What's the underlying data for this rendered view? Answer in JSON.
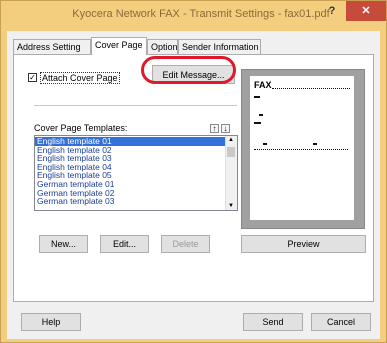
{
  "window": {
    "title": "Kyocera Network FAX - Transmit Settings - fax01.pdf",
    "help_glyph": "?",
    "close_glyph": "✕"
  },
  "tabs": [
    {
      "label": "Address Setting"
    },
    {
      "label": "Cover Page"
    },
    {
      "label": "Option"
    },
    {
      "label": "Sender Information"
    }
  ],
  "cover_page": {
    "attach_label": "Attach Cover Page",
    "attach_checked": "✓",
    "edit_message_label": "Edit Message...",
    "templates_label": "Cover Page Templates:",
    "sort_up": "↑",
    "sort_down": "↓",
    "templates": [
      "English template 01",
      "English template 02",
      "English template 03",
      "English template 04",
      "English template 05",
      "German template 01",
      "German template 02",
      "German template 03"
    ],
    "selected_index": 0,
    "new_label": "New...",
    "edit_label": "Edit...",
    "delete_label": "Delete",
    "preview_label": "Preview",
    "preview_page_title": "FAX"
  },
  "footer": {
    "help_label": "Help",
    "send_label": "Send",
    "cancel_label": "Cancel"
  },
  "colors": {
    "title_bar": "#f3ce7f",
    "close_button": "#c74b3b",
    "selection": "#3370d8",
    "highlight_ring": "#e0182b"
  }
}
